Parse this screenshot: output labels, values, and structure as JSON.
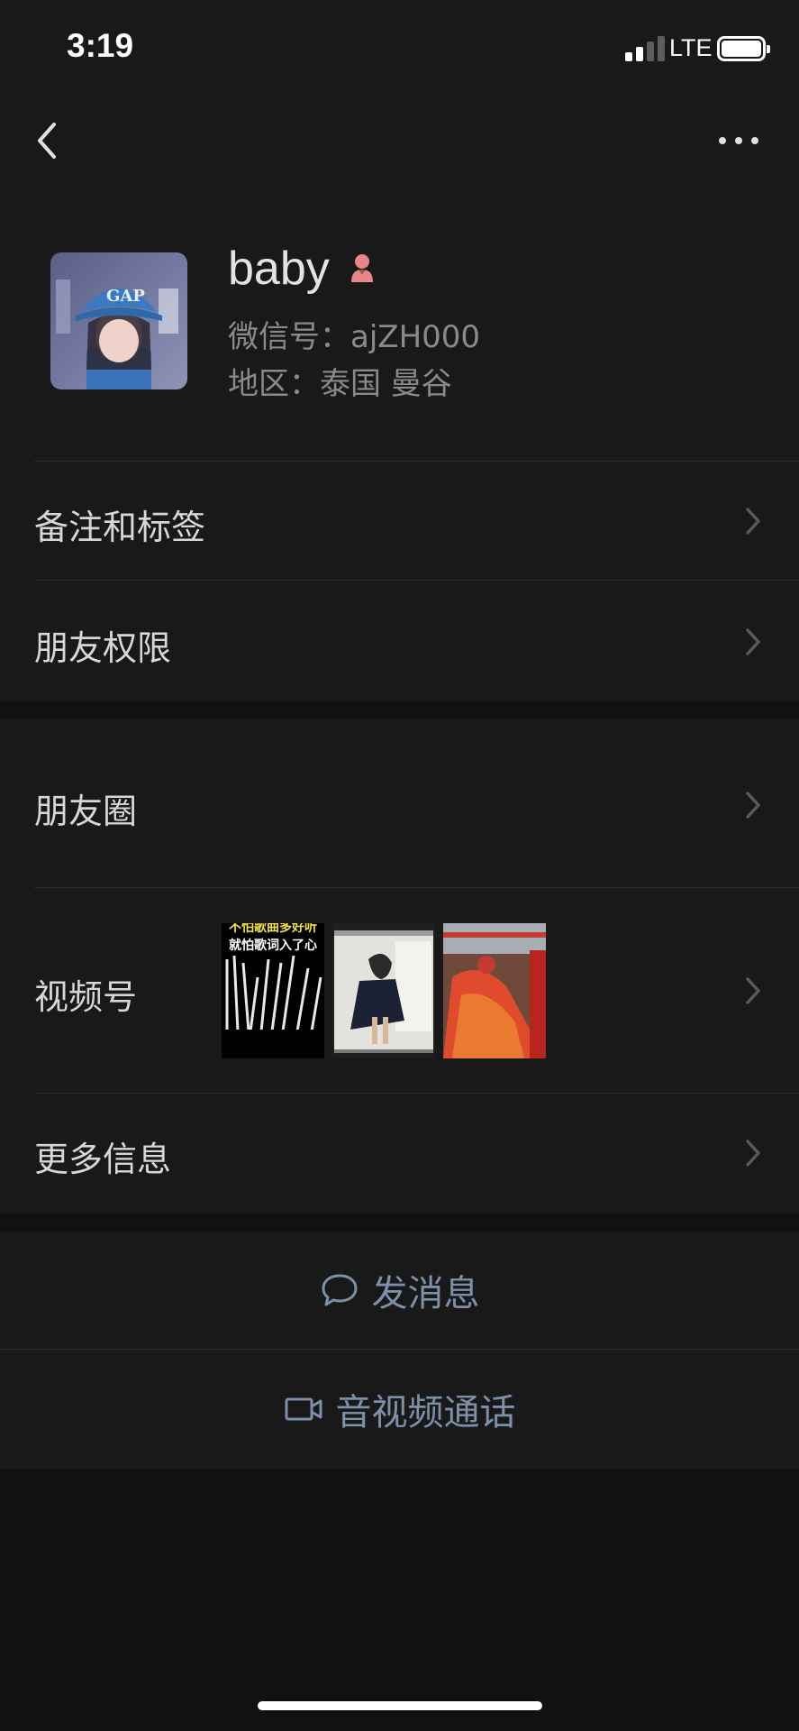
{
  "status_bar": {
    "time": "3:19",
    "network": "LTE"
  },
  "profile": {
    "name": "baby",
    "wechat_id": "微信号：ajZH000",
    "region": "地区：泰国 曼谷"
  },
  "rows": {
    "remarks_tags": "备注和标签",
    "friend_permissions": "朋友权限",
    "moments": "朋友圈",
    "channels": "视频号",
    "more_info": "更多信息"
  },
  "channel_thumbs": [
    {
      "line1": "不怕歌曲多好听",
      "line2": "就怕歌词入了心"
    },
    {
      "line1": ""
    },
    {
      "line1": ""
    }
  ],
  "actions": {
    "send_message": "发消息",
    "video_call": "音视频通话"
  },
  "colors": {
    "background": "#111111",
    "cell": "#191919",
    "action_text": "#7d90a9",
    "gender_female": "#e8868a"
  },
  "icons": {
    "back": "chevron-left-icon",
    "more": "more-dots-icon",
    "gender": "female-icon",
    "chevron": "chevron-right-icon",
    "message": "chat-bubble-icon",
    "video": "video-camera-icon"
  }
}
